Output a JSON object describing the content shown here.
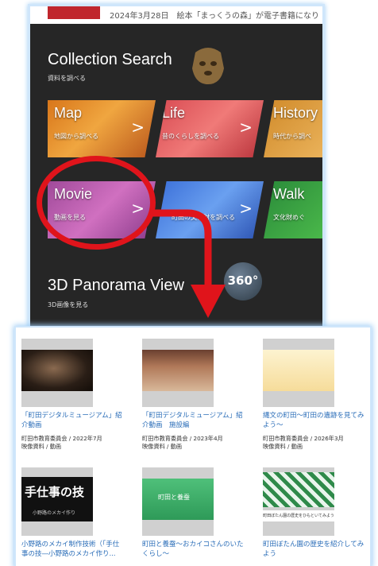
{
  "news": {
    "date": "2024年3月28日",
    "text": "絵本「まっくうの森」が電子書籍になり"
  },
  "collection": {
    "title": "Collection Search",
    "subtitle": "資料を調べる"
  },
  "tiles": [
    {
      "label": "Map",
      "sub": "地図から調べる"
    },
    {
      "label": "Life",
      "sub": "昔のくらしを調べる"
    },
    {
      "label": "History",
      "sub": "時代から調べ"
    },
    {
      "label": "Movie",
      "sub": "動画を見る"
    },
    {
      "label": "",
      "sub": "町田の文化財を調べる"
    },
    {
      "label": "Walk",
      "sub": "文化財めぐ"
    }
  ],
  "panorama": {
    "title": "3D Panorama View",
    "subtitle": "3D画像を見る",
    "badge": "360°"
  },
  "results": [
    {
      "title": "「町田デジタルミュージアム」紹介動画",
      "publisher": "町田市教育委員会 / 2022年7月",
      "type": "映像資料 / 動画"
    },
    {
      "title": "「町田デジタルミュージアム」紹介動画　施設編",
      "publisher": "町田市教育委員会 / 2023年4月",
      "type": "映像資料 / 動画"
    },
    {
      "title": "縄文の町田～町田の遺跡を見てみよう～",
      "publisher": "町田市教育委員会 / 2026年3月",
      "type": "映像資料 / 動画"
    },
    {
      "title": "小野路のメカイ制作技術（「手仕事の技―小野路のメカイ作り...",
      "thumb_text": "手仕事の技",
      "thumb_sub": "小野路のメカイ作り"
    },
    {
      "title": "町田と養蚕～おカイコさんのいたくらし～",
      "thumb_text": "町田と養蚕"
    },
    {
      "title": "町田ぼたん園の歴史を紹介してみよう",
      "thumb_text": "町田ぼたん園の歴史をひもといてみよう"
    }
  ],
  "colors": {
    "accent_red": "#e0141b",
    "link_blue": "#2a6db8",
    "panel_bg": "#262626"
  }
}
